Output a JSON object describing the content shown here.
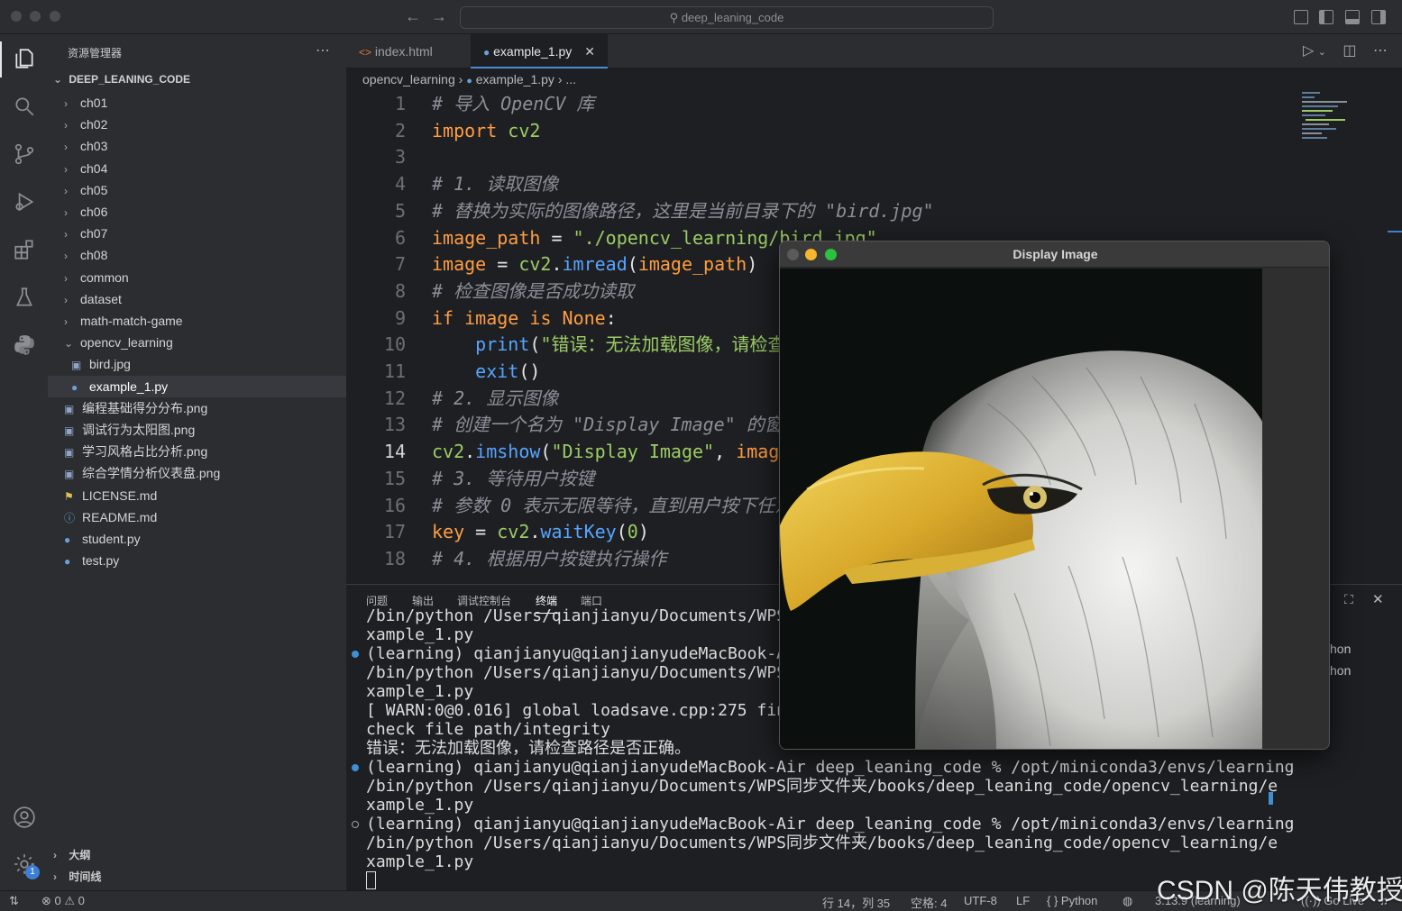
{
  "titlebar": {
    "search_text": "deep_leaning_code",
    "back_icon": "arrow-left-icon",
    "forward_icon": "arrow-right-icon"
  },
  "activity_bar": {
    "items": [
      "explorer-icon",
      "search-icon",
      "source-control-icon",
      "run-debug-icon",
      "extensions-icon",
      "testing-icon",
      "python-icon",
      "account-icon",
      "settings-gear-icon"
    ],
    "settings_badge": "1"
  },
  "sidebar": {
    "title": "资源管理器",
    "root": "DEEP_LEANING_CODE",
    "items": [
      {
        "label": "ch01",
        "kind": "folder"
      },
      {
        "label": "ch02",
        "kind": "folder"
      },
      {
        "label": "ch03",
        "kind": "folder"
      },
      {
        "label": "ch04",
        "kind": "folder"
      },
      {
        "label": "ch05",
        "kind": "folder"
      },
      {
        "label": "ch06",
        "kind": "folder"
      },
      {
        "label": "ch07",
        "kind": "folder"
      },
      {
        "label": "ch08",
        "kind": "folder"
      },
      {
        "label": "common",
        "kind": "folder"
      },
      {
        "label": "dataset",
        "kind": "folder"
      },
      {
        "label": "math-match-game",
        "kind": "folder"
      },
      {
        "label": "opencv_learning",
        "kind": "folder-open"
      },
      {
        "label": "bird.jpg",
        "kind": "image"
      },
      {
        "label": "example_1.py",
        "kind": "python"
      },
      {
        "label": "编程基础得分分布.png",
        "kind": "image"
      },
      {
        "label": "调试行为太阳图.png",
        "kind": "image"
      },
      {
        "label": "学习风格占比分析.png",
        "kind": "image"
      },
      {
        "label": "综合学情分析仪表盘.png",
        "kind": "image"
      },
      {
        "label": "LICENSE.md",
        "kind": "license"
      },
      {
        "label": "README.md",
        "kind": "info"
      },
      {
        "label": "student.py",
        "kind": "python"
      },
      {
        "label": "test.py",
        "kind": "python"
      }
    ],
    "outline": "大纲",
    "timeline": "时间线"
  },
  "tabs": [
    {
      "label": "index.html",
      "icon": "html-icon"
    },
    {
      "label": "example_1.py",
      "icon": "python-icon",
      "close": "✕"
    }
  ],
  "breadcrumb": {
    "folder": "opencv_learning",
    "file": "example_1.py",
    "more": "..."
  },
  "editor": {
    "current_line": 14,
    "lines": [
      {
        "n": "1",
        "t": [
          {
            "c": "cm",
            "s": "# 导入 OpenCV 库"
          }
        ]
      },
      {
        "n": "2",
        "t": [
          {
            "c": "kw",
            "s": "import"
          },
          {
            "c": "op",
            "s": " "
          },
          {
            "c": "str",
            "s": "cv2"
          }
        ]
      },
      {
        "n": "3",
        "t": []
      },
      {
        "n": "4",
        "t": [
          {
            "c": "cm",
            "s": "# 1. 读取图像"
          }
        ]
      },
      {
        "n": "5",
        "t": [
          {
            "c": "cm",
            "s": "# 替换为实际的图像路径，这里是当前目录下的 \"bird.jpg\""
          }
        ]
      },
      {
        "n": "6",
        "t": [
          {
            "c": "var",
            "s": "image_path"
          },
          {
            "c": "op",
            "s": " = "
          },
          {
            "c": "str",
            "s": "\"./opencv_learning/bird.jpg\""
          }
        ]
      },
      {
        "n": "7",
        "t": [
          {
            "c": "var",
            "s": "image"
          },
          {
            "c": "op",
            "s": " = "
          },
          {
            "c": "str",
            "s": "cv2"
          },
          {
            "c": "op",
            "s": "."
          },
          {
            "c": "fn",
            "s": "imread"
          },
          {
            "c": "op",
            "s": "("
          },
          {
            "c": "var",
            "s": "image_path"
          },
          {
            "c": "op",
            "s": ")"
          }
        ]
      },
      {
        "n": "8",
        "t": [
          {
            "c": "cm",
            "s": "# 检查图像是否成功读取"
          }
        ]
      },
      {
        "n": "9",
        "t": [
          {
            "c": "kw",
            "s": "if"
          },
          {
            "c": "op",
            "s": " "
          },
          {
            "c": "var",
            "s": "image"
          },
          {
            "c": "op",
            "s": " "
          },
          {
            "c": "kw",
            "s": "is"
          },
          {
            "c": "op",
            "s": " "
          },
          {
            "c": "kw",
            "s": "None"
          },
          {
            "c": "op",
            "s": ":"
          }
        ]
      },
      {
        "n": "10",
        "t": [
          {
            "c": "op",
            "s": "    "
          },
          {
            "c": "fn",
            "s": "print"
          },
          {
            "c": "op",
            "s": "("
          },
          {
            "c": "str",
            "s": "\"错误：无法加载图像，请检查"
          }
        ]
      },
      {
        "n": "11",
        "t": [
          {
            "c": "op",
            "s": "    "
          },
          {
            "c": "fn",
            "s": "exit"
          },
          {
            "c": "op",
            "s": "()"
          }
        ]
      },
      {
        "n": "12",
        "t": [
          {
            "c": "cm",
            "s": "# 2. 显示图像"
          }
        ]
      },
      {
        "n": "13",
        "t": [
          {
            "c": "cm",
            "s": "# 创建一个名为 \"Display Image\" 的窗"
          }
        ]
      },
      {
        "n": "14",
        "t": [
          {
            "c": "str",
            "s": "cv2"
          },
          {
            "c": "op",
            "s": "."
          },
          {
            "c": "fn",
            "s": "imshow"
          },
          {
            "c": "op",
            "s": "("
          },
          {
            "c": "str",
            "s": "\"Display Image\""
          },
          {
            "c": "op",
            "s": ", "
          },
          {
            "c": "var",
            "s": "imag"
          }
        ]
      },
      {
        "n": "15",
        "t": [
          {
            "c": "cm",
            "s": "# 3. 等待用户按键"
          }
        ]
      },
      {
        "n": "16",
        "t": [
          {
            "c": "cm",
            "s": "# 参数 0 表示无限等待，直到用户按下任意"
          }
        ]
      },
      {
        "n": "17",
        "t": [
          {
            "c": "var",
            "s": "key"
          },
          {
            "c": "op",
            "s": " = "
          },
          {
            "c": "str",
            "s": "cv2"
          },
          {
            "c": "op",
            "s": "."
          },
          {
            "c": "fn",
            "s": "waitKey"
          },
          {
            "c": "op",
            "s": "("
          },
          {
            "c": "str",
            "s": "0"
          },
          {
            "c": "op",
            "s": ")"
          }
        ]
      },
      {
        "n": "18",
        "t": [
          {
            "c": "cm",
            "s": "# 4. 根据用户按键执行操作"
          }
        ]
      }
    ]
  },
  "panel": {
    "tabs": [
      "问题",
      "输出",
      "调试控制台",
      "终端",
      "端口"
    ],
    "active_tab": "终端",
    "terminal": [
      {
        "dot": "",
        "text": "/bin/python /Users/qianjianyu/Documents/WPS同步文件夹"
      },
      {
        "dot": "",
        "text": "xample_1.py"
      },
      {
        "dot": "filled",
        "text": "(learning) qianjianyu@qianjianyudeMacBook-Air"
      },
      {
        "dot": "",
        "text": "/bin/python /Users/qianjianyu/Documents/WPS同"
      },
      {
        "dot": "",
        "text": "xample_1.py"
      },
      {
        "dot": "",
        "text": "[ WARN:0@0.016] global loadsave.cpp:275 find"
      },
      {
        "dot": "",
        "text": "check file path/integrity"
      },
      {
        "dot": "",
        "text": "错误：无法加载图像，请检查路径是否正确。"
      },
      {
        "dot": "filled",
        "text": "(learning) qianjianyu@qianjianyudeMacBook-Air deep_leaning_code % /opt/miniconda3/envs/learning"
      },
      {
        "dot": "",
        "text": "/bin/python /Users/qianjianyu/Documents/WPS同步文件夹/books/deep_leaning_code/opencv_learning/e"
      },
      {
        "dot": "",
        "text": "xample_1.py"
      },
      {
        "dot": "hollow",
        "text": "(learning) qianjianyu@qianjianyudeMacBook-Air deep_leaning_code % /opt/miniconda3/envs/learning"
      },
      {
        "dot": "",
        "text": "/bin/python /Users/qianjianyu/Documents/WPS同步文件夹/books/deep_leaning_code/opencv_learning/e"
      },
      {
        "dot": "",
        "text": "xample_1.py"
      }
    ],
    "right_items": [
      "hon",
      "hon"
    ]
  },
  "statusbar": {
    "errors": "0",
    "warnings": "0",
    "position": "行 14，列 35",
    "spaces": "空格: 4",
    "encoding": "UTF-8",
    "eol": "LF",
    "language": "{ } Python",
    "interpreter": "3.13.9 (learning)",
    "golive": "Go Live"
  },
  "image_window": {
    "title": "Display Image"
  },
  "watermark": "CSDN @陈天伟教授",
  "colors": {
    "accent": "#4a8bd6",
    "comment": "#8a8f98",
    "keyword": "#ff9d42",
    "function": "#57a4ff",
    "string": "#9ccc65"
  }
}
